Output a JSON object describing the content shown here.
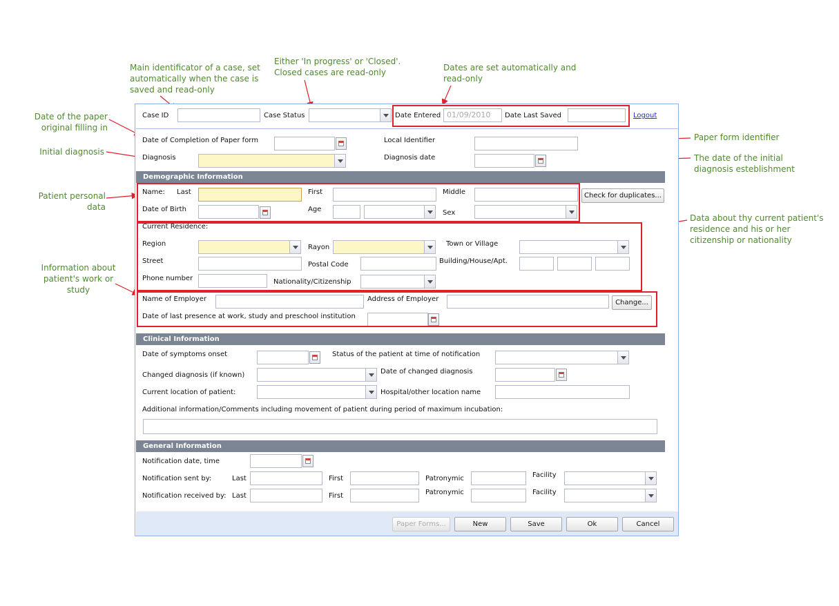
{
  "annotations": {
    "case_id": "Main identificator of a case, set automatically when the case is saved and read-only",
    "case_status": "Either 'In progress' or 'Closed'. Closed cases are read-only",
    "dates": "Dates are set automatically and read-only",
    "date_paper": "Date of the paper original filling in",
    "initial_diagnosis": "Initial diagnosis",
    "patient_personal": "Patient personal data",
    "paper_form_id": "Paper form identifier",
    "diagnosis_date": "The date of the initial diagnosis esteblishment",
    "residence": "Data about thy current patient's residence and his or her citizenship or nationality",
    "work": "Information about patient's work or study"
  },
  "header": {
    "case_id_label": "Case ID",
    "case_status_label": "Case Status",
    "date_entered_label": "Date Entered",
    "date_entered_value": "01/09/2010",
    "date_last_saved_label": "Date Last Saved",
    "logout": "Logout"
  },
  "general_top": {
    "date_completion_label": "Date of Completion of Paper form",
    "local_identifier_label": "Local Identifier",
    "diagnosis_label": "Diagnosis",
    "diagnosis_date_label": "Diagnosis date"
  },
  "demographic": {
    "title": "Demographic Information",
    "name_label": "Name:",
    "last_label": "Last",
    "first_label": "First",
    "middle_label": "Middle",
    "check_duplicates": "Check for duplicates...",
    "dob_label": "Date of Birth",
    "age_label": "Age",
    "sex_label": "Sex",
    "current_residence_label": "Current Residence:",
    "region_label": "Region",
    "rayon_label": "Rayon",
    "town_label": "Town or Village",
    "street_label": "Street",
    "postal_label": "Postal Code",
    "building_label": "Building/House/Apt.",
    "phone_label": "Phone number",
    "nationality_label": "Nationality/Citizenship",
    "employer_name_label": "Name of Employer",
    "employer_address_label": "Address of Employer",
    "change_button": "Change...",
    "last_presence_label": "Date of last presence at work, study and preschool institution"
  },
  "clinical": {
    "title": "Clinical Information",
    "symptoms_label": "Date of symptoms onset",
    "status_label": "Status of the patient at time of notification",
    "changed_diag_label": "Changed diagnosis (if known)",
    "changed_diag_date_label": "Date of changed diagnosis",
    "location_label": "Current location of patient:",
    "hospital_label": "Hospital/other location name",
    "comments_label": "Additional information/Comments including movement of patient during period of maximum incubation:"
  },
  "general": {
    "title": "General Information",
    "notif_date_label": "Notification date, time",
    "sent_by_label": "Notification sent by:",
    "received_by_label": "Notification received by:",
    "last_label": "Last",
    "first_label": "First",
    "patronymic_label": "Patronymic",
    "facility_label": "Facility"
  },
  "buttons": {
    "paper_forms": "Paper Forms...",
    "new": "New",
    "save": "Save",
    "ok": "Ok",
    "cancel": "Cancel"
  }
}
